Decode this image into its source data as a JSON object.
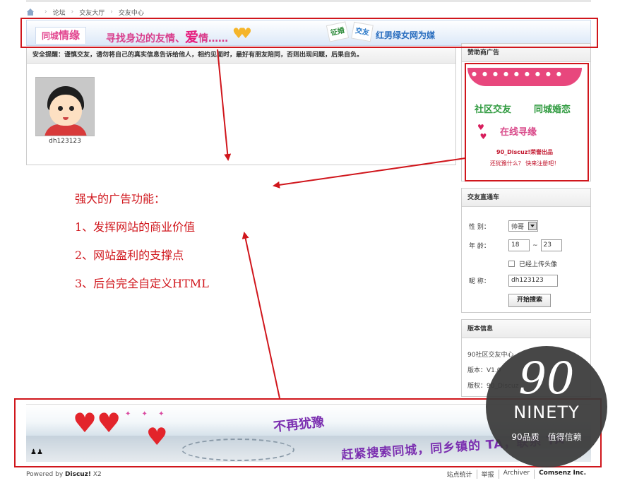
{
  "breadcrumb": {
    "items": [
      "论坛",
      "交友大厅",
      "交友中心"
    ]
  },
  "banner": {
    "tab_small": "同城",
    "tab_big": "情缘",
    "slogan_pre": "寻找身边的友情、",
    "slogan_big": "爱",
    "slogan_post": "情……",
    "stamp_one": "征婚",
    "stamp_two": "交友",
    "right_text": "红男绿女网为媒"
  },
  "main": {
    "notice": "安全提醒：谨慎交友，请勿将自己的真实信息告诉给他人，相约见面时，最好有朋友陪同，否则出现问题，后果自负。",
    "username": "dh123123"
  },
  "sponsor": {
    "title": "赞助商广告",
    "ad_line1": "社区交友",
    "ad_line2": "同城婚恋",
    "ad_line3": "在线寻缘",
    "ad_line4": "90_Discuz!荣誉出品",
    "ad_line5": "还犹豫什么？ 快来注册吧！"
  },
  "search": {
    "title": "交友直通车",
    "gender_label": "性 别：",
    "gender_value": "帅哥",
    "age_label": "年 龄：",
    "age_min": "18",
    "age_sep": "~",
    "age_max": "23",
    "avatar_checkbox_label": "已经上传头像",
    "nick_label": "昵 称：",
    "nick_value": "dh123123",
    "submit_label": "开始搜索"
  },
  "version": {
    "title": "版本信息",
    "line1": "90社区交友中心",
    "line2": "版本：V1.0",
    "line3": "版权：90_Discuz"
  },
  "annotation": {
    "title": "强大的广告功能：",
    "point1": "1、发挥网站的商业价值",
    "point2": "2、网站盈利的支撑点",
    "point3": "3、后台完全自定义HTML"
  },
  "bottom_banner": {
    "tag1": "不再犹豫",
    "tag2": "赶紧搜索同城，同乡镇的 TA，联系 TA"
  },
  "footer": {
    "powered_prefix": "Powered by ",
    "powered_brand": "Discuz!",
    "powered_version": " X2",
    "links": [
      "站点统计",
      "举报",
      "Archiver",
      "Comsenz Inc."
    ]
  },
  "watermark": {
    "number": "90",
    "word": "NINETY",
    "tagline": "90品质　值得信赖"
  },
  "colors": {
    "annotation_red": "#d0161c",
    "ad_pink": "#e8477d",
    "ad_green": "#2e9a3e"
  }
}
